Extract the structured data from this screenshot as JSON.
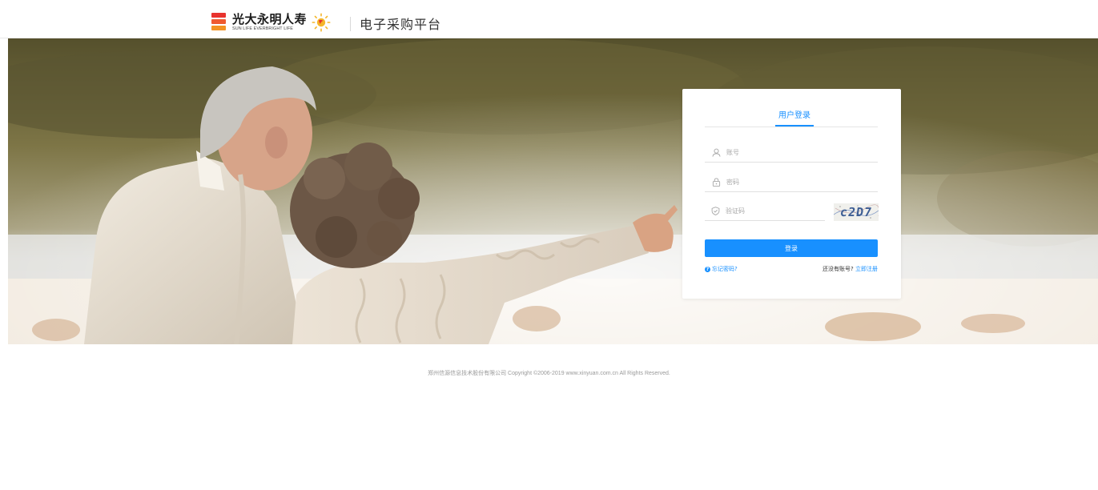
{
  "header": {
    "logo_cn": "光大永明人寿",
    "logo_en": "SUN LIFE EVERBRIGHT LIFE",
    "platform_title": "电子采购平台"
  },
  "login": {
    "tab_label": "用户登录",
    "username_placeholder": "账号",
    "password_placeholder": "密码",
    "captcha_placeholder": "验证码",
    "captcha_text": "c2D7",
    "submit_label": "登录",
    "forgot_label": "忘记密码?",
    "no_account_text": "还没有账号?",
    "register_label": "立即注册"
  },
  "footer": {
    "copyright": "郑州信源信息技术股份有限公司 Copyright ©2006-2019 www.xinyuan.com.cn All Rights Reserved."
  },
  "colors": {
    "accent": "#1890ff",
    "logo_red": "#e8332e",
    "logo_orange": "#f39323"
  }
}
